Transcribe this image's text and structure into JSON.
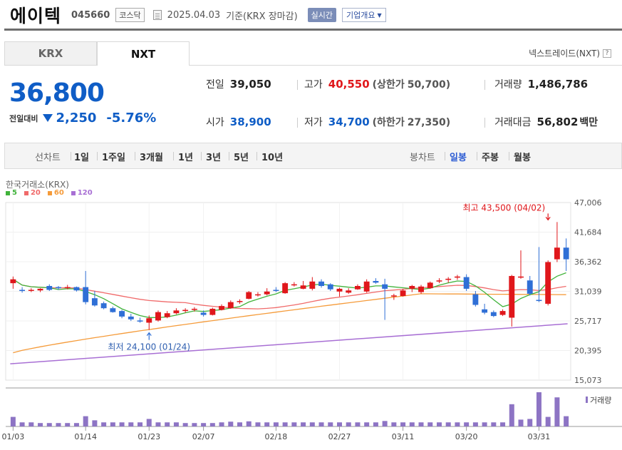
{
  "header": {
    "name": "에이텍",
    "code": "045660",
    "market": "코스닥",
    "date": "2025.04.03",
    "basis": "기준(KRX 장마감)",
    "realtime": "실시간",
    "company_overview": "기업개요"
  },
  "tabs": [
    {
      "label": "KRX",
      "selected": false
    },
    {
      "label": "NXT",
      "selected": true
    }
  ],
  "nextrade_label": "넥스트레이드(NXT)",
  "price": {
    "current": "36,800",
    "change_label": "전일대비",
    "change": "2,250",
    "change_pct": "-5.76%",
    "direction": "down"
  },
  "stats": {
    "prev_label": "전일",
    "prev": "39,050",
    "high_label": "고가",
    "high": "40,550",
    "upper_label": "(상한가",
    "upper": "50,700)",
    "volume_label": "거래량",
    "volume": "1,486,786",
    "open_label": "시가",
    "open": "38,900",
    "low_label": "저가",
    "low": "34,700",
    "lower_label": "(하한가",
    "lower": "27,350)",
    "amount_label": "거래대금",
    "amount": "56,802",
    "amount_unit": "백만"
  },
  "period": {
    "line_label": "선차트",
    "line_items": [
      "1일",
      "1주일",
      "3개월",
      "1년",
      "3년",
      "5년",
      "10년"
    ],
    "candle_label": "봉차트",
    "candle_items": [
      "일봉",
      "주봉",
      "월봉"
    ],
    "candle_selected": "일봉"
  },
  "colors": {
    "up": "#e0171b",
    "down": "#2f6fd6",
    "ma5": "#41b33b",
    "ma20": "#f06a6a",
    "ma60": "#f59b3a",
    "ma120": "#a86fd4",
    "volume": "#8d74c4"
  },
  "chart_data": {
    "type": "candlestick",
    "source": "한국거래소(KRX)",
    "legend": [
      {
        "name": "5",
        "color": "#41b33b"
      },
      {
        "name": "20",
        "color": "#f06a6a"
      },
      {
        "name": "60",
        "color": "#f59b3a"
      },
      {
        "name": "120",
        "color": "#a86fd4"
      }
    ],
    "ylim": [
      15073,
      47006
    ],
    "y_ticks": [
      "47,006",
      "41,684",
      "36,362",
      "31,039",
      "25,717",
      "20,395",
      "15,073"
    ],
    "x_ticks": [
      "01/03",
      "01/14",
      "01/23",
      "02/07",
      "02/18",
      "02/27",
      "03/11",
      "03/20",
      "03/31"
    ],
    "x_tick_index": [
      0,
      8,
      15,
      21,
      29,
      36,
      43,
      50,
      58
    ],
    "max_annotation": "최고 43,500 (04/02)",
    "max_index": 59,
    "max_value": 43500,
    "min_annotation": "최저 24,100 (01/24)",
    "min_index": 15,
    "min_value": 24100,
    "volume_label": "거래량",
    "candles": [
      [
        32500,
        33700,
        31500,
        33200
      ],
      [
        31300,
        31800,
        30800,
        31100
      ],
      [
        31200,
        31600,
        30900,
        31300
      ],
      [
        31200,
        31600,
        30900,
        31500
      ],
      [
        32000,
        32300,
        31100,
        31300
      ],
      [
        31800,
        32000,
        31300,
        31600
      ],
      [
        31700,
        32200,
        31400,
        31800
      ],
      [
        31800,
        31900,
        31000,
        31200
      ],
      [
        31800,
        34700,
        28700,
        29100
      ],
      [
        29800,
        31100,
        28300,
        28500
      ],
      [
        28900,
        29200,
        27800,
        28000
      ],
      [
        28000,
        28300,
        27200,
        27300
      ],
      [
        27500,
        27700,
        26200,
        26500
      ],
      [
        26500,
        27000,
        25700,
        26000
      ],
      [
        25800,
        26300,
        25400,
        25600
      ],
      [
        25400,
        26700,
        24100,
        26200
      ],
      [
        25800,
        27600,
        25600,
        27300
      ],
      [
        26400,
        27500,
        26200,
        27100
      ],
      [
        27100,
        28000,
        26900,
        27600
      ],
      [
        27500,
        28000,
        27200,
        27700
      ],
      [
        27800,
        28200,
        27400,
        27900
      ],
      [
        27200,
        27600,
        26500,
        26800
      ],
      [
        26800,
        28100,
        26700,
        27900
      ],
      [
        27700,
        28700,
        27600,
        28400
      ],
      [
        28000,
        29400,
        27900,
        29100
      ],
      [
        29100,
        29600,
        28800,
        29300
      ],
      [
        29700,
        31100,
        29600,
        30900
      ],
      [
        30500,
        30900,
        30100,
        30500
      ],
      [
        30500,
        31600,
        30300,
        31000
      ],
      [
        31300,
        31800,
        30900,
        31200
      ],
      [
        30700,
        32700,
        30600,
        32500
      ],
      [
        32300,
        32700,
        31900,
        32300
      ],
      [
        31500,
        32900,
        31400,
        32100
      ],
      [
        31500,
        33600,
        31200,
        32800
      ],
      [
        32800,
        33200,
        31700,
        32000
      ],
      [
        32300,
        32500,
        31100,
        31400
      ],
      [
        31000,
        31700,
        30100,
        31500
      ],
      [
        30800,
        31600,
        30600,
        31200
      ],
      [
        31400,
        32300,
        31300,
        32000
      ],
      [
        31000,
        33200,
        30800,
        32800
      ],
      [
        32900,
        33400,
        32400,
        32600
      ],
      [
        32300,
        33300,
        25900,
        31500
      ],
      [
        30200,
        30600,
        29500,
        30300
      ],
      [
        30200,
        31500,
        30100,
        31200
      ],
      [
        31500,
        32200,
        30900,
        32000
      ],
      [
        30900,
        32200,
        30600,
        31900
      ],
      [
        31600,
        32800,
        31500,
        32600
      ],
      [
        32800,
        33400,
        32500,
        33000
      ],
      [
        33100,
        33600,
        32600,
        33300
      ],
      [
        33500,
        34000,
        33100,
        33700
      ],
      [
        33600,
        34100,
        31100,
        31500
      ],
      [
        30500,
        31100,
        28300,
        28600
      ],
      [
        27800,
        28800,
        26900,
        27200
      ],
      [
        27300,
        27600,
        26400,
        26600
      ],
      [
        26800,
        27800,
        26600,
        27500
      ],
      [
        26300,
        34000,
        24700,
        33800
      ],
      [
        33500,
        38400,
        33300,
        33700
      ],
      [
        33000,
        33800,
        30300,
        30600
      ],
      [
        29500,
        39000,
        29100,
        29300
      ],
      [
        28800,
        36600,
        28500,
        36300
      ],
      [
        36800,
        43500,
        36300,
        38900
      ],
      [
        38900,
        40550,
        34700,
        36800
      ]
    ],
    "volume_relative": [
      0.28,
      0.12,
      0.12,
      0.1,
      0.1,
      0.1,
      0.1,
      0.1,
      0.3,
      0.18,
      0.12,
      0.12,
      0.12,
      0.12,
      0.12,
      0.22,
      0.12,
      0.12,
      0.12,
      0.1,
      0.1,
      0.1,
      0.1,
      0.12,
      0.14,
      0.12,
      0.15,
      0.12,
      0.12,
      0.12,
      0.12,
      0.12,
      0.12,
      0.12,
      0.12,
      0.12,
      0.12,
      0.12,
      0.12,
      0.12,
      0.12,
      0.16,
      0.12,
      0.12,
      0.12,
      0.12,
      0.12,
      0.12,
      0.12,
      0.12,
      0.12,
      0.12,
      0.12,
      0.12,
      0.12,
      0.65,
      0.2,
      0.22,
      1.0,
      0.28,
      0.85,
      0.3
    ],
    "ma120": [
      [
        0,
        18000
      ],
      [
        61,
        25200
      ]
    ]
  }
}
